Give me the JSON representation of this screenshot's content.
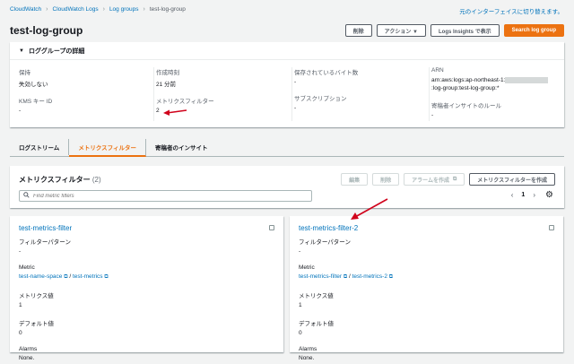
{
  "breadcrumb": {
    "items": [
      "CloudWatch",
      "CloudWatch Logs",
      "Log groups"
    ],
    "current": "test-log-group"
  },
  "switch_link": "元のインターフェイスに切り替えます。",
  "header": {
    "title": "test-log-group",
    "delete_label": "削除",
    "actions_label": "アクション ▼",
    "insights_label": "Logs Insights で表示",
    "search_label": "Search log group"
  },
  "details": {
    "title": "ロググループの詳細",
    "retention_label": "保持",
    "retention_value": "失効しない",
    "created_label": "作成時刻",
    "created_value": "21 分前",
    "stored_bytes_label": "保存されているバイト数",
    "stored_bytes_value": "-",
    "arn_label": "ARN",
    "arn_value_prefix": "arn:aws:logs:ap-northeast-1:",
    "arn_value_suffix": ":log-group:test-log-group:*",
    "kms_label": "KMS キー ID",
    "kms_value": "-",
    "metric_filters_label": "メトリクスフィルター",
    "metric_filters_value": "2",
    "subscription_label": "サブスクリプション",
    "subscription_value": "-",
    "contributor_label": "寄稿者インサイトのルール",
    "contributor_value": "-"
  },
  "tabs": [
    {
      "label": "ログストリーム",
      "active": false
    },
    {
      "label": "メトリクスフィルター",
      "active": true
    },
    {
      "label": "寄稿者のインサイト",
      "active": false
    }
  ],
  "filters": {
    "title": "メトリクスフィルター",
    "count": "(2)",
    "edit_label": "編集",
    "delete_label": "削除",
    "alarm_label": "アラームを作成",
    "create_label": "メトリクスフィルターを作成",
    "search_placeholder": "Find metric filters",
    "page": "1"
  },
  "cards": [
    {
      "name": "test-metrics-filter",
      "pattern_label": "フィルターパターン",
      "pattern_value": "-",
      "metric_label": "Metric",
      "metric_namespace": "test-name-space",
      "metric_name": "test-metrics",
      "value_label": "メトリクス値",
      "value_value": "1",
      "default_label": "デフォルト値",
      "default_value": "0",
      "alarms_label": "Alarms",
      "alarms_value": "None."
    },
    {
      "name": "test-metrics-filter-2",
      "pattern_label": "フィルターパターン",
      "pattern_value": "-",
      "metric_label": "Metric",
      "metric_namespace": "test-metrics-filter",
      "metric_name": "test-metrics-2",
      "value_label": "メトリクス値",
      "value_value": "1",
      "default_label": "デフォルト値",
      "default_value": "0",
      "alarms_label": "Alarms",
      "alarms_value": "None."
    }
  ],
  "colors": {
    "accent": "#ec7211",
    "link": "#0073bb",
    "annotation": "#d0021b"
  }
}
